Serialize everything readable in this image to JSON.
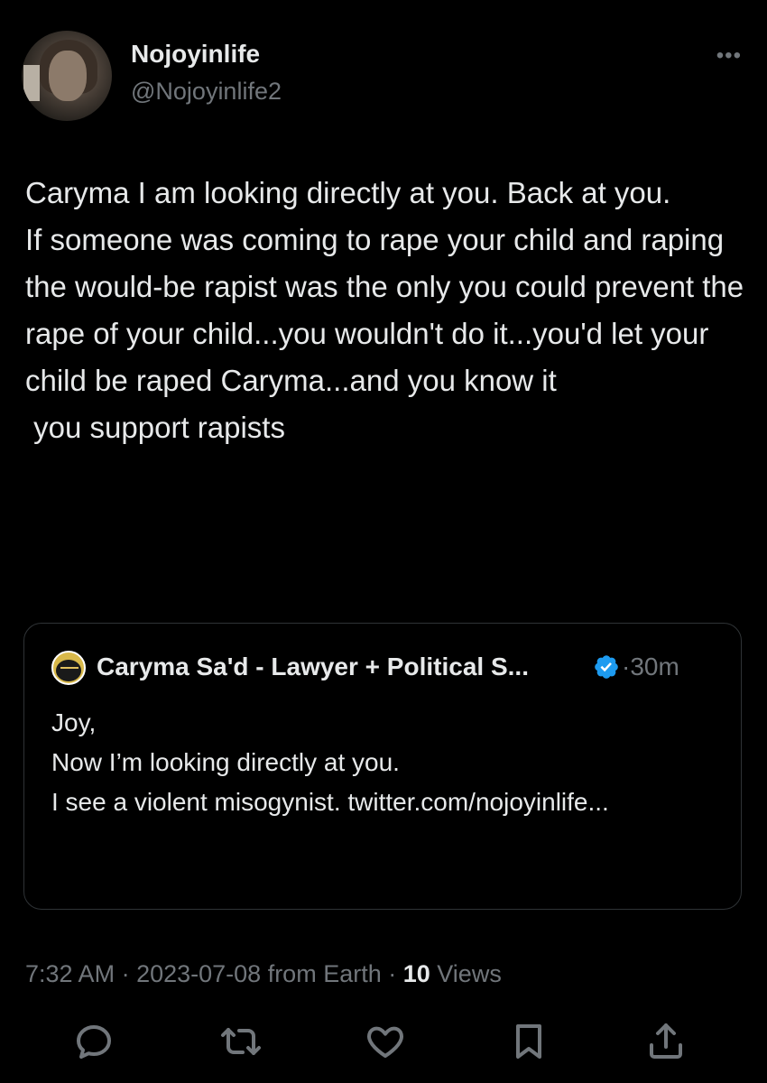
{
  "author": {
    "display_name": "Nojoyinlife",
    "handle": "@Nojoyinlife2"
  },
  "more_icon": "more-horizontal-icon",
  "tweet": {
    "paragraphs": [
      "Caryma I am looking directly at you. Back at you.",
      "",
      "If someone was coming to rape your child and raping the would-be rapist was the only you could prevent the rape of your child...you wouldn't do it...you'd let your child be raped Caryma...and you know it",
      "",
      " you support rapists"
    ]
  },
  "quote": {
    "name": "Caryma Sa'd - Lawyer + Political S...",
    "verified_color": "#1d9bf0",
    "time": "·30m",
    "paragraphs": [
      "Joy,",
      "",
      "Now I’m looking directly at you.",
      "",
      "I see a violent misogynist. twitter.com/nojoyinlife..."
    ]
  },
  "meta": {
    "time": "7:32 AM",
    "sep1": " · ",
    "date": "2023-07-08",
    "location": " from Earth",
    "sep2": " · ",
    "views_count": "10",
    "views_label": " Views"
  },
  "actions": [
    "reply-icon",
    "retweet-icon",
    "like-icon",
    "bookmark-icon",
    "share-icon"
  ],
  "colors": {
    "background": "#000000",
    "text": "#e7e9ea",
    "secondary": "#71767b",
    "border": "#2f3336"
  }
}
